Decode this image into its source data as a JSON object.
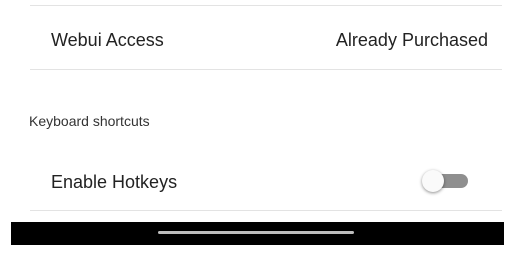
{
  "settings": {
    "webui_access": {
      "label": "Webui Access",
      "value": "Already Purchased"
    },
    "section_header": "Keyboard shortcuts",
    "enable_hotkeys": {
      "label": "Enable Hotkeys",
      "enabled": false
    }
  },
  "colors": {
    "toggle_track_off": "#8f8f8f",
    "toggle_thumb_off": "#fafafa",
    "nav_bar": "#000000"
  }
}
